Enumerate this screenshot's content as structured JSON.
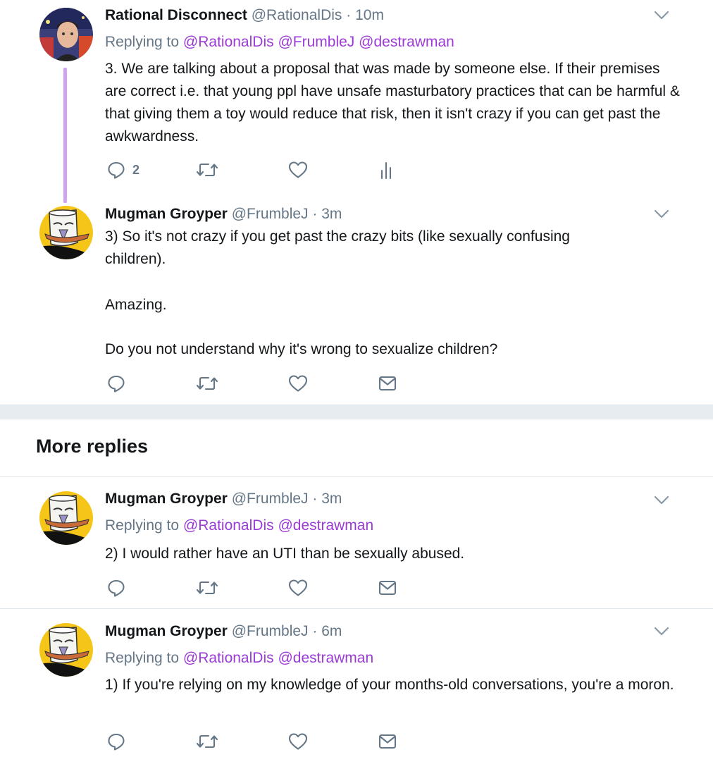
{
  "tweets": [
    {
      "name": "Rational Disconnect",
      "handle": "@RationalDis",
      "dot": "·",
      "time": "10m",
      "replying_prefix": "Replying to",
      "mentions": [
        "@RationalDis",
        "@FrumbleJ",
        "@destrawman"
      ],
      "body": [
        "3. We are talking about a proposal that was made by someone else. If their premises are correct i.e. that young ppl have unsafe masturbatory practices that can be harmful & that giving them a toy would reduce that risk, then it isn't crazy if you can get past the awkwardness."
      ],
      "reply_count": "2"
    },
    {
      "name": "Mugman Groyper",
      "handle": "@FrumbleJ",
      "dot": "·",
      "time": "3m",
      "body": [
        "3) So it's not crazy if you get past the crazy bits (like sexually confusing children).",
        "Amazing.",
        "Do you not understand why it's wrong to sexualize children?"
      ]
    },
    {
      "name": "Mugman Groyper",
      "handle": "@FrumbleJ",
      "dot": "·",
      "time": "3m",
      "replying_prefix": "Replying to",
      "mentions": [
        "@RationalDis",
        "@destrawman"
      ],
      "body": [
        "2) I would rather have an UTI than be sexually abused."
      ]
    },
    {
      "name": "Mugman Groyper",
      "handle": "@FrumbleJ",
      "dot": "·",
      "time": "6m",
      "replying_prefix": "Replying to",
      "mentions": [
        "@RationalDis",
        "@destrawman"
      ],
      "body": [
        "1) If you're relying on my knowledge of your months-old conversations, you're a moron."
      ]
    }
  ],
  "section": {
    "more_replies": "More replies"
  },
  "colors": {
    "mention": "#9b3bd6",
    "thread_line": "#cfa3ef",
    "secondary": "#657786"
  },
  "icons": [
    "reply-icon",
    "retweet-icon",
    "like-icon",
    "analytics-icon",
    "direct-message-icon",
    "chevron-down-icon"
  ]
}
